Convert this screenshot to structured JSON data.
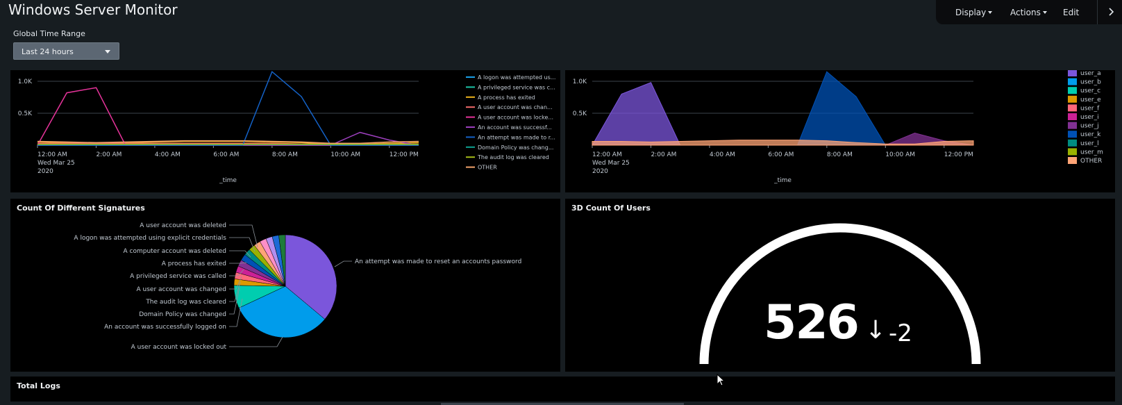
{
  "header": {
    "title": "Windows Server Monitor"
  },
  "menubar": {
    "display": "Display",
    "actions": "Actions",
    "edit": "Edit"
  },
  "filters": {
    "global_time_range_label": "Global Time Range",
    "global_time_range_value": "Last 24 hours"
  },
  "colors": {
    "bg": "#171d21",
    "panel": "#000000"
  },
  "panels": {
    "signatures_title": "Count Of Different Signatures",
    "users3d_title": "3D Count Of Users",
    "total_logs_title": "Total Logs"
  },
  "kpi": {
    "value": "526",
    "arrow": "↓",
    "delta": "-2"
  },
  "chart_data": [
    {
      "type": "line",
      "xlabel": "_time",
      "y_ticks": [
        "1.0K",
        "0.5K"
      ],
      "x_ticks": [
        "12:00 AM",
        "2:00 AM",
        "4:00 AM",
        "6:00 AM",
        "8:00 AM",
        "10:00 AM",
        "12:00 PM"
      ],
      "x_subtitle": [
        "Wed Mar 25",
        "2020"
      ],
      "legend_position": "right",
      "series": [
        {
          "name": "A logon was attempted us...",
          "color": "#1a9fe8",
          "values": [
            0,
            0,
            0,
            0,
            0,
            0,
            0,
            0,
            0,
            0,
            0,
            0,
            0,
            0
          ]
        },
        {
          "name": "A privileged service was c...",
          "color": "#1dc4a8",
          "values": [
            20,
            20,
            20,
            20,
            20,
            20,
            20,
            20,
            20,
            20,
            20,
            20,
            20,
            20
          ]
        },
        {
          "name": "A process has exited",
          "color": "#ecb31b",
          "values": [
            50,
            40,
            30,
            40,
            50,
            60,
            60,
            60,
            50,
            40,
            20,
            20,
            30,
            40
          ]
        },
        {
          "name": "A user account was chan...",
          "color": "#f36b6b",
          "values": [
            30,
            30,
            30,
            30,
            30,
            30,
            30,
            30,
            30,
            20,
            20,
            20,
            20,
            20
          ]
        },
        {
          "name": "A user account was locke...",
          "color": "#e6339a",
          "values": [
            0,
            820,
            900,
            0,
            0,
            0,
            0,
            0,
            0,
            0,
            0,
            0,
            0,
            0
          ]
        },
        {
          "name": "An account was successf...",
          "color": "#9c3fbd",
          "values": [
            0,
            0,
            0,
            0,
            0,
            0,
            0,
            0,
            0,
            0,
            0,
            200,
            80,
            0
          ]
        },
        {
          "name": "An attempt was made to r...",
          "color": "#1462c7",
          "values": [
            0,
            0,
            0,
            0,
            0,
            0,
            0,
            0,
            1150,
            760,
            0,
            0,
            0,
            0
          ]
        },
        {
          "name": "Domain Policy was chang...",
          "color": "#0ea292",
          "values": [
            10,
            10,
            10,
            10,
            10,
            10,
            10,
            10,
            10,
            10,
            10,
            10,
            10,
            10
          ]
        },
        {
          "name": "The audit log was cleared",
          "color": "#a6bc19",
          "values": [
            15,
            15,
            15,
            15,
            15,
            15,
            15,
            15,
            15,
            15,
            15,
            15,
            15,
            15
          ]
        },
        {
          "name": "OTHER",
          "color": "#f2a36b",
          "values": [
            60,
            50,
            40,
            50,
            60,
            70,
            70,
            70,
            60,
            50,
            30,
            30,
            50,
            60
          ]
        }
      ]
    },
    {
      "type": "area",
      "xlabel": "_time",
      "y_ticks": [
        "1.0K",
        "0.5K"
      ],
      "x_ticks": [
        "12:00 AM",
        "2:00 AM",
        "4:00 AM",
        "6:00 AM",
        "8:00 AM",
        "10:00 AM",
        "12:00 PM"
      ],
      "x_subtitle": [
        "Wed Mar 25",
        "2020"
      ],
      "legend_position": "right",
      "series": [
        {
          "name": "user_a",
          "color": "#7b56db",
          "values": [
            0,
            800,
            980,
            0,
            0,
            0,
            0,
            0,
            0,
            0,
            0,
            0,
            0,
            0
          ]
        },
        {
          "name": "user_b",
          "color": "#009ceb",
          "values": [
            0,
            0,
            0,
            0,
            0,
            0,
            0,
            0,
            0,
            0,
            0,
            0,
            0,
            0
          ]
        },
        {
          "name": "user_c",
          "color": "#00cdaf",
          "values": [
            0,
            0,
            0,
            0,
            0,
            0,
            0,
            0,
            0,
            0,
            0,
            0,
            0,
            0
          ]
        },
        {
          "name": "user_e",
          "color": "#dd9900",
          "values": [
            0,
            0,
            0,
            0,
            0,
            0,
            0,
            0,
            0,
            0,
            0,
            0,
            0,
            0
          ]
        },
        {
          "name": "user_f",
          "color": "#ff677b",
          "values": [
            0,
            0,
            0,
            0,
            0,
            0,
            0,
            0,
            0,
            0,
            0,
            0,
            0,
            0
          ]
        },
        {
          "name": "user_i",
          "color": "#cb2196",
          "values": [
            0,
            0,
            0,
            0,
            0,
            0,
            0,
            0,
            0,
            0,
            0,
            0,
            0,
            0
          ]
        },
        {
          "name": "user_j",
          "color": "#813193",
          "values": [
            0,
            0,
            0,
            0,
            0,
            0,
            0,
            0,
            0,
            0,
            0,
            190,
            70,
            0
          ]
        },
        {
          "name": "user_k",
          "color": "#0051b5",
          "values": [
            0,
            0,
            0,
            0,
            0,
            0,
            0,
            0,
            1150,
            760,
            0,
            0,
            0,
            0
          ]
        },
        {
          "name": "user_l",
          "color": "#008c80",
          "values": [
            0,
            0,
            0,
            0,
            0,
            0,
            0,
            0,
            0,
            0,
            0,
            0,
            0,
            0
          ]
        },
        {
          "name": "user_m",
          "color": "#99b100",
          "values": [
            0,
            0,
            0,
            0,
            0,
            0,
            0,
            0,
            0,
            0,
            0,
            0,
            0,
            0
          ]
        },
        {
          "name": "OTHER",
          "color": "#ffa476",
          "values": [
            60,
            60,
            50,
            60,
            70,
            80,
            80,
            80,
            70,
            40,
            20,
            20,
            60,
            70
          ]
        }
      ]
    },
    {
      "type": "pie",
      "title": "Count Of Different Signatures",
      "slices": [
        {
          "label": "An attempt was made to reset an accounts password",
          "value": 35,
          "color": "#7b56db"
        },
        {
          "label": "A user account was locked out",
          "value": 31,
          "color": "#009ceb"
        },
        {
          "label": "An account was successfully logged on",
          "value": 7,
          "color": "#00cdaf"
        },
        {
          "label": "Domain Policy was changed",
          "value": 2,
          "color": "#dd9900"
        },
        {
          "label": "The audit log was cleared",
          "value": 2,
          "color": "#ff677b"
        },
        {
          "label": "A user account was changed",
          "value": 2,
          "color": "#cb2196"
        },
        {
          "label": "A privileged service was called",
          "value": 2,
          "color": "#813193"
        },
        {
          "label": "A process has exited",
          "value": 2,
          "color": "#0051b5"
        },
        {
          "label": "A computer account was deleted",
          "value": 2,
          "color": "#008c80"
        },
        {
          "label": "A logon was attempted using explicit credentials",
          "value": 2,
          "color": "#99b100"
        },
        {
          "label": "A user account was deleted",
          "value": 2,
          "color": "#ffa476"
        },
        {
          "label": "",
          "value": 2,
          "color": "#ff8fc7"
        },
        {
          "label": "",
          "value": 2,
          "color": "#b18ef0"
        },
        {
          "label": "",
          "value": 2,
          "color": "#1b6ad6"
        },
        {
          "label": "",
          "value": 2,
          "color": "#1e7b3a"
        }
      ]
    }
  ]
}
